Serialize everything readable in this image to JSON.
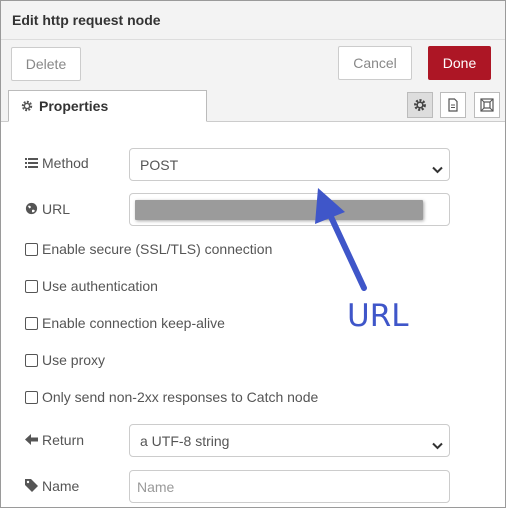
{
  "dialog": {
    "title": "Edit http request node"
  },
  "toolbar": {
    "delete_label": "Delete",
    "cancel_label": "Cancel",
    "done_label": "Done"
  },
  "tabs": {
    "properties_label": "Properties",
    "icons": [
      "gear-icon",
      "document-icon",
      "frame-icon"
    ]
  },
  "form": {
    "method": {
      "label": "Method",
      "value": "POST",
      "icon": "list-icon"
    },
    "url": {
      "label": "URL",
      "value": "",
      "icon": "globe-icon"
    },
    "checkboxes": [
      {
        "label": "Enable secure (SSL/TLS) connection",
        "checked": false
      },
      {
        "label": "Use authentication",
        "checked": false
      },
      {
        "label": "Enable connection keep-alive",
        "checked": false
      },
      {
        "label": "Use proxy",
        "checked": false
      },
      {
        "label": "Only send non-2xx responses to Catch node",
        "checked": false
      }
    ],
    "return": {
      "label": "Return",
      "value": "a UTF-8 string",
      "icon": "arrow-left-icon"
    },
    "name": {
      "label": "Name",
      "placeholder": "Name",
      "value": "",
      "icon": "tag-icon"
    }
  },
  "annotation": {
    "text": "URL",
    "color": "#3f56c9"
  },
  "colors": {
    "done_button": "#ad1625",
    "header_background": "#f3f3f3"
  }
}
